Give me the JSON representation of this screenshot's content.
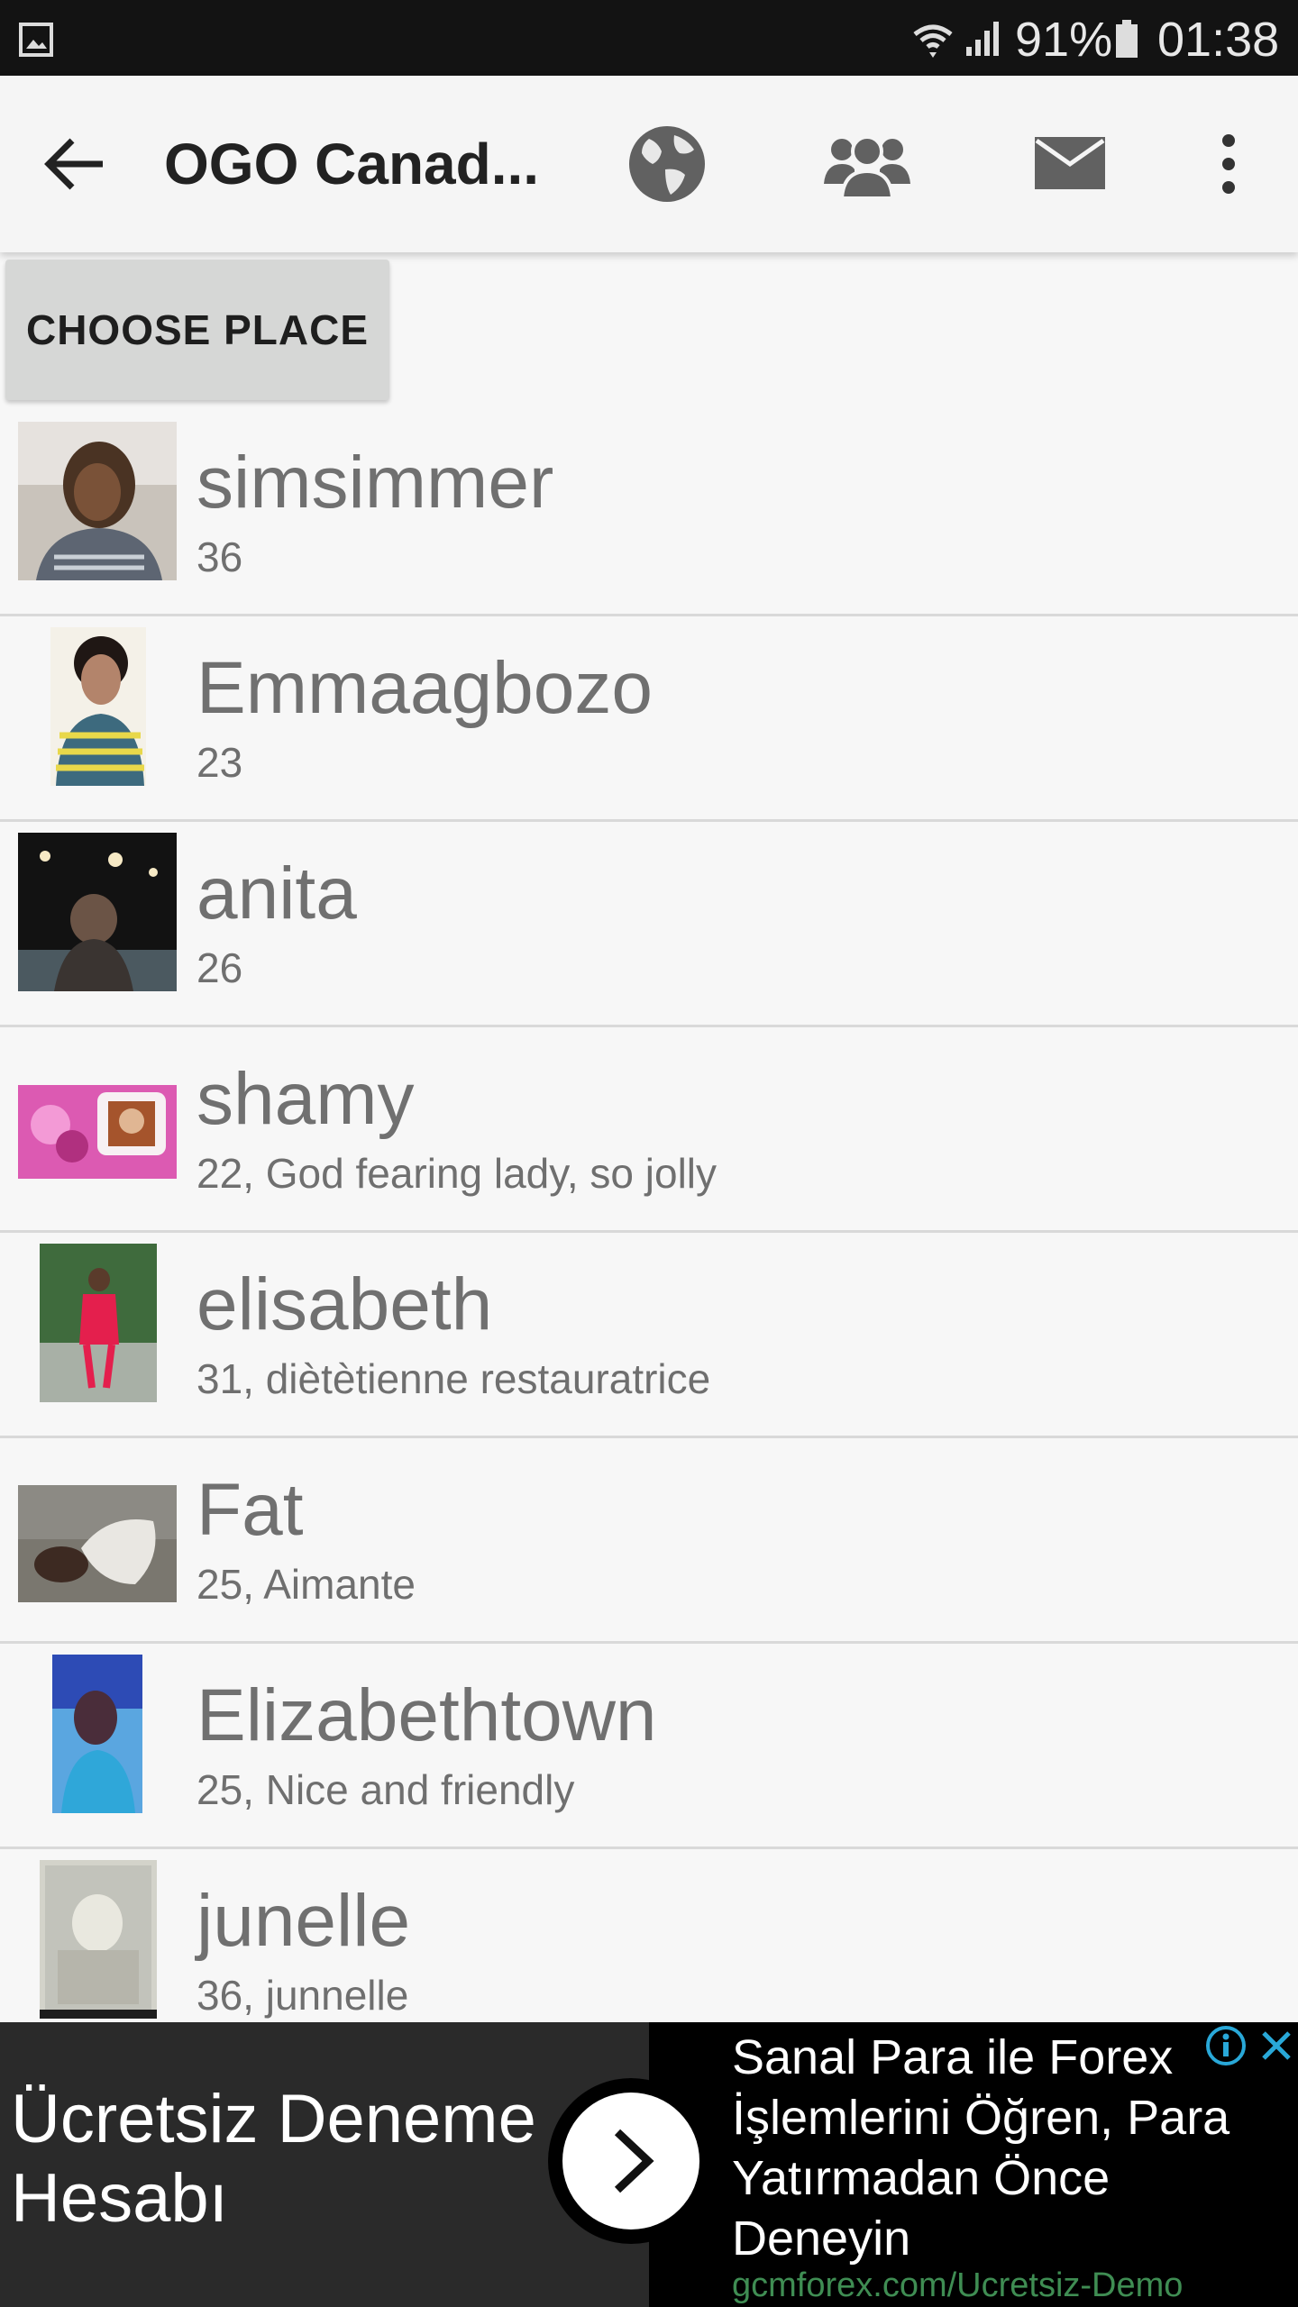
{
  "status_bar": {
    "battery_percent": "91%",
    "time": "01:38",
    "icons": [
      "gallery-icon",
      "wifi-icon",
      "signal-icon",
      "battery-icon"
    ]
  },
  "toolbar": {
    "title": "OGO Canad...",
    "icons": [
      "back-arrow-icon",
      "globe-icon",
      "people-icon",
      "mail-icon",
      "more-vert-icon"
    ]
  },
  "choose_place": {
    "label": "CHOOSE PLACE"
  },
  "users": [
    {
      "name": "simsimmer",
      "subtitle": "36"
    },
    {
      "name": "Emmaagbozo",
      "subtitle": "23"
    },
    {
      "name": "anita",
      "subtitle": "26"
    },
    {
      "name": "shamy",
      "subtitle": "22, God fearing lady, so jolly"
    },
    {
      "name": "elisabeth",
      "subtitle": "31, diètètienne restauratrice"
    },
    {
      "name": "Fat",
      "subtitle": "25, Aimante"
    },
    {
      "name": "Elizabethtown",
      "subtitle": "25, Nice and friendly"
    },
    {
      "name": "junelle",
      "subtitle": "36, junnelle"
    }
  ],
  "ad": {
    "left_line1": "Ücretsiz Deneme",
    "left_line2": "Hesabı",
    "right_text": "Sanal Para ile Forex İşlemlerini Öğren, Para Yatırmadan Önce Deneyin",
    "url": "gcmforex.com/Ucretsiz-Demo",
    "colors": {
      "url": "#3f8d53",
      "info": "#29a8d8"
    }
  }
}
